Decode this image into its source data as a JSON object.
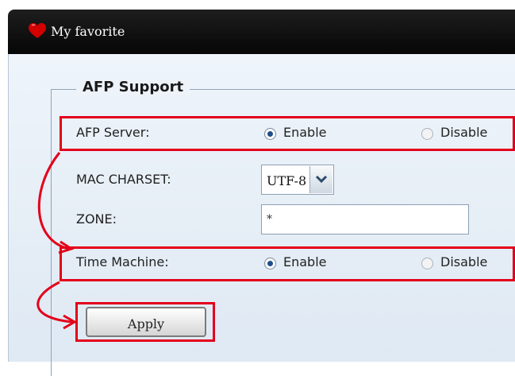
{
  "header": {
    "title": "My favorite",
    "icon": "heart-icon",
    "icon_color": "#d40000"
  },
  "section": {
    "legend": "AFP Support"
  },
  "afp_server": {
    "label": "AFP Server:",
    "options": [
      "Enable",
      "Disable"
    ],
    "selected": "Enable"
  },
  "mac_charset": {
    "label": "MAC CHARSET:",
    "value": "UTF-8",
    "icon": "chevron-down-icon"
  },
  "zone": {
    "label": "ZONE:",
    "value": "*"
  },
  "time_machine": {
    "label": "Time Machine:",
    "options": [
      "Enable",
      "Disable"
    ],
    "selected": "Enable"
  },
  "apply_button": {
    "label": "Apply"
  },
  "colors": {
    "highlight": "#e3001b",
    "radio_selected": "#1f4f8a",
    "title_bar": "#0b0b0b"
  }
}
